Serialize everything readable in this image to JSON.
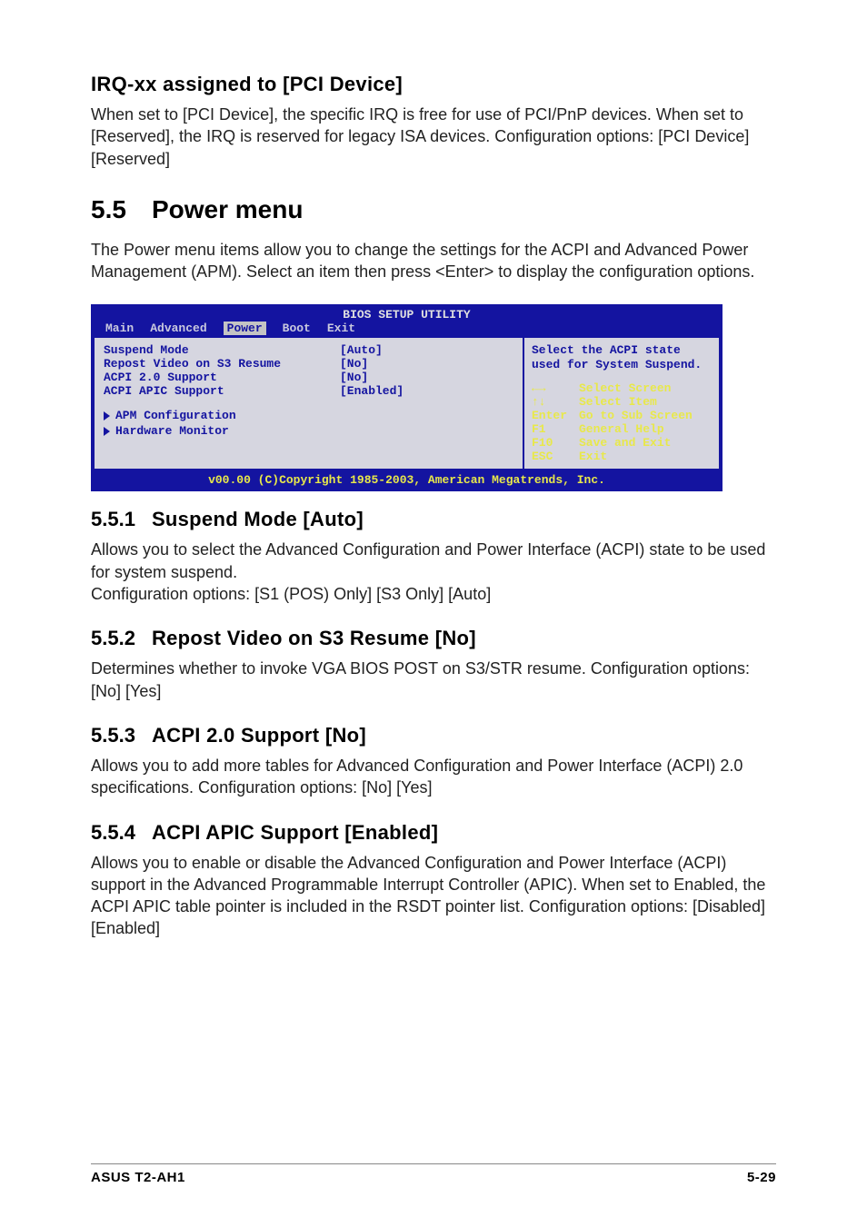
{
  "intro_h3": "IRQ-xx assigned to [PCI Device]",
  "intro_body": "When set to [PCI Device], the specific IRQ is free for use of PCI/PnP devices. When set to [Reserved], the IRQ is reserved for legacy ISA devices. Configuration options: [PCI Device] [Reserved]",
  "h2_num": "5.5",
  "h2_title": "Power menu",
  "h2_body": "The Power menu items allow you to change the settings for the ACPI and Advanced Power Management (APM). Select an item then press <Enter> to display the configuration options.",
  "bios": {
    "title": "BIOS SETUP UTILITY",
    "menu": {
      "main": "Main",
      "advanced": "Advanced",
      "power": "Power",
      "boot": "Boot",
      "exit": "Exit"
    },
    "opts": [
      {
        "label": "Suspend Mode",
        "val": "[Auto]"
      },
      {
        "label": "Repost Video on S3 Resume",
        "val": "[No]"
      },
      {
        "label": "ACPI 2.0 Support",
        "val": "[No]"
      },
      {
        "label": "ACPI APIC Support",
        "val": "[Enabled]"
      }
    ],
    "subs": [
      {
        "label": "APM Configuration"
      },
      {
        "label": "Hardware Monitor"
      }
    ],
    "help": "Select the ACPI state used for System Suspend.",
    "nav": [
      {
        "key": "←→",
        "label": "Select Screen"
      },
      {
        "key": "↑↓",
        "label": "Select Item"
      },
      {
        "key": "Enter",
        "label": "Go to Sub Screen"
      },
      {
        "key": "F1",
        "label": "General Help"
      },
      {
        "key": "F10",
        "label": "Save and Exit"
      },
      {
        "key": "ESC",
        "label": "Exit"
      }
    ],
    "footer": "v00.00 (C)Copyright 1985-2003, American Megatrends, Inc."
  },
  "s551": {
    "num": "5.5.1",
    "title": "Suspend Mode [Auto]",
    "body": "Allows you to select the Advanced Configuration and Power Interface (ACPI) state to be used for system suspend.\nConfiguration options: [S1 (POS) Only] [S3 Only] [Auto]"
  },
  "s552": {
    "num": "5.5.2",
    "title": "Repost Video on S3 Resume [No]",
    "body": "Determines whether to invoke VGA BIOS POST on S3/STR resume. Configuration options: [No] [Yes]"
  },
  "s553": {
    "num": "5.5.3",
    "title": "ACPI 2.0 Support [No]",
    "body": "Allows you to add more tables for Advanced Configuration and Power Interface (ACPI) 2.0 specifications. Configuration options: [No] [Yes]"
  },
  "s554": {
    "num": "5.5.4",
    "title": "ACPI APIC Support [Enabled]",
    "body": "Allows you to enable or disable the Advanced Configuration and Power Interface (ACPI) support in the Advanced Programmable Interrupt Controller (APIC). When set to Enabled, the ACPI APIC table pointer is included in the RSDT pointer list. Configuration options: [Disabled] [Enabled]"
  },
  "footer": {
    "left": "ASUS T2-AH1",
    "right": "5-29"
  }
}
